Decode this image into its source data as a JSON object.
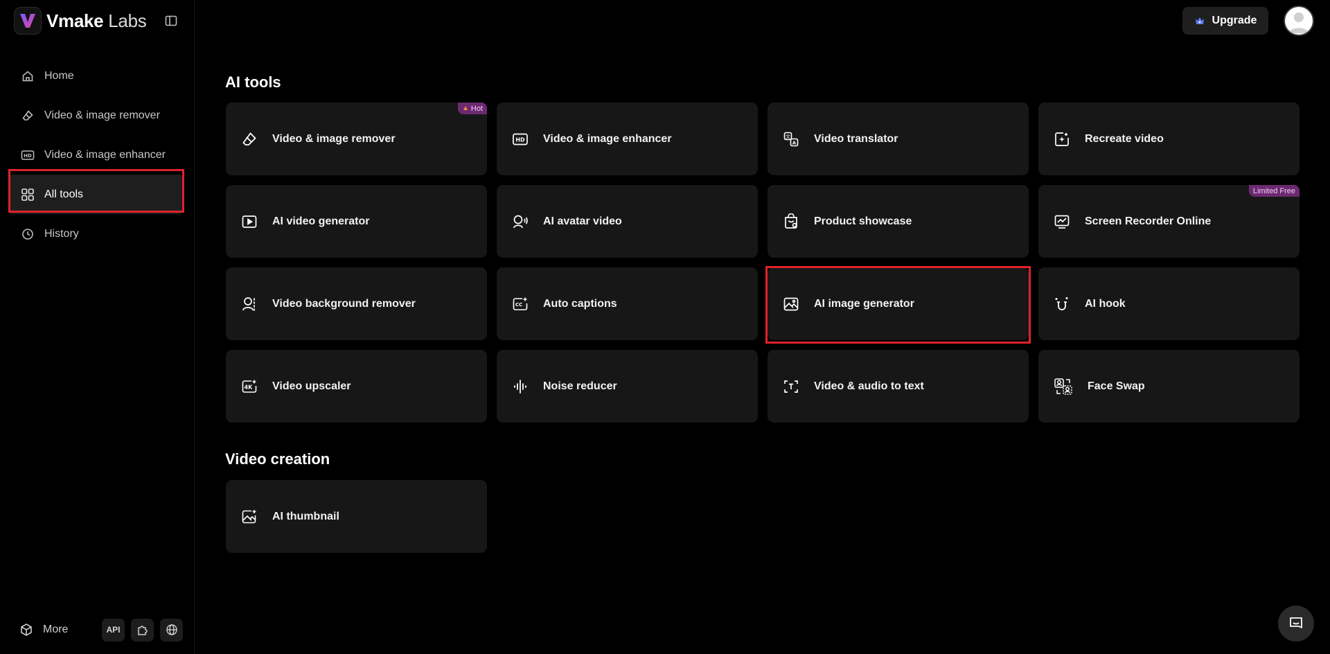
{
  "brand": {
    "name_bold": "Vmake",
    "name_light": " Labs"
  },
  "sidebar": {
    "items": [
      {
        "label": "Home",
        "icon": "home-icon"
      },
      {
        "label": "Video & image remover",
        "icon": "eraser-icon"
      },
      {
        "label": "Video & image enhancer",
        "icon": "hd-icon"
      },
      {
        "label": "All tools",
        "icon": "grid-icon",
        "active": true
      },
      {
        "label": "History",
        "icon": "clock-icon"
      }
    ],
    "more_label": "More",
    "api_label": "API"
  },
  "header": {
    "upgrade_label": "Upgrade"
  },
  "sections": {
    "ai_tools": {
      "title": "AI tools",
      "tools": [
        {
          "label": "Video & image remover",
          "badge": "Hot"
        },
        {
          "label": "Video & image enhancer"
        },
        {
          "label": "Video translator"
        },
        {
          "label": "Recreate video"
        },
        {
          "label": "AI video generator"
        },
        {
          "label": "AI avatar video"
        },
        {
          "label": "Product showcase"
        },
        {
          "label": "Screen Recorder Online",
          "badge": "Limited Free"
        },
        {
          "label": "Video background remover"
        },
        {
          "label": "Auto captions"
        },
        {
          "label": "AI image generator"
        },
        {
          "label": "AI hook"
        },
        {
          "label": "Video upscaler"
        },
        {
          "label": "Noise reducer"
        },
        {
          "label": "Video & audio to text"
        },
        {
          "label": "Face Swap"
        }
      ]
    },
    "video_creation": {
      "title": "Video creation",
      "tools": [
        {
          "label": "AI thumbnail"
        }
      ]
    }
  },
  "colors": {
    "background": "#000000",
    "card": "#171717",
    "highlight": "#e0222b",
    "badge": "#6b2a6f"
  }
}
